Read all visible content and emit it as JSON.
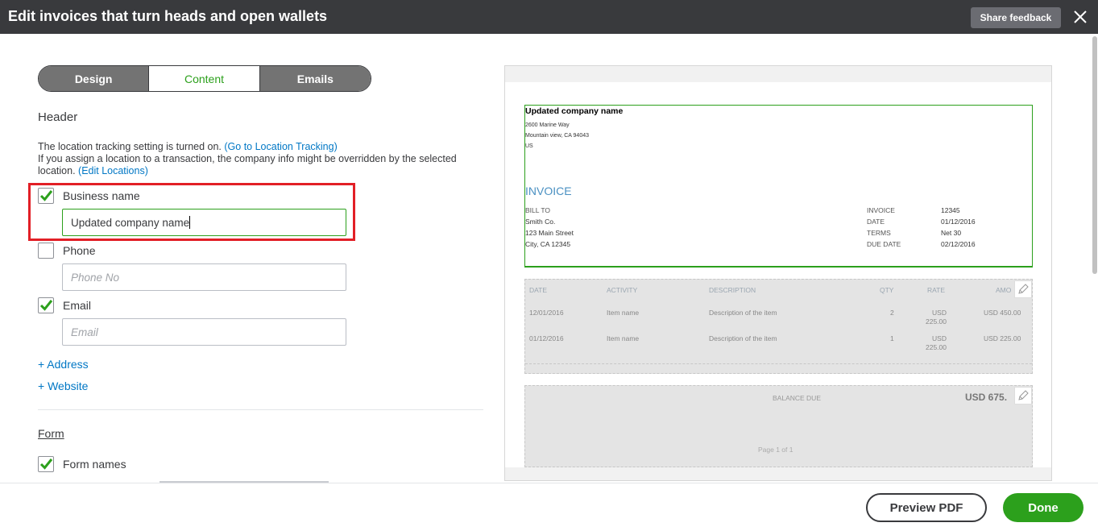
{
  "title": "Edit invoices that turn heads and open wallets",
  "share_feedback": "Share feedback",
  "tabs": [
    {
      "label": "Design"
    },
    {
      "label": "Content"
    },
    {
      "label": "Emails"
    }
  ],
  "header_section": {
    "title": "Header",
    "info_line1": "The location tracking setting is turned on. ",
    "info_link1": "(Go to Location Tracking)",
    "info_line2": "If you assign a location to a transaction, the company info might be overridden by the selected location. ",
    "info_link2": "(Edit Locations)",
    "business_name": {
      "label": "Business name",
      "checked": true,
      "value": "Updated company name"
    },
    "phone": {
      "label": "Phone",
      "checked": false,
      "placeholder": "Phone No"
    },
    "email": {
      "label": "Email",
      "checked": true,
      "placeholder": "Email"
    },
    "add_address": "+ Address",
    "add_website": "+ Website"
  },
  "form_section": {
    "title": "Form",
    "form_names": {
      "label": "Form names",
      "checked": true
    }
  },
  "preview": {
    "company_name": "Updated company name",
    "address_lines": [
      "2600 Marine Way",
      "Mountain view, CA 94043",
      "US"
    ],
    "invoice_title": "INVOICE",
    "bill_to_label": "BILL TO",
    "bill_to_lines": [
      "Smith Co.",
      "123 Main Street",
      "City, CA 12345"
    ],
    "meta": [
      {
        "label": "INVOICE",
        "value": "12345"
      },
      {
        "label": "DATE",
        "value": "01/12/2016"
      },
      {
        "label": "TERMS",
        "value": "Net 30"
      },
      {
        "label": "DUE DATE",
        "value": "02/12/2016"
      }
    ],
    "columns": [
      "DATE",
      "ACTIVITY",
      "DESCRIPTION",
      "QTY",
      "RATE",
      "AMO"
    ],
    "rows": [
      {
        "date": "12/01/2016",
        "activity": "Item name",
        "description": "Description of the item",
        "qty": "2",
        "rate_line1": "USD",
        "rate_line2": "225.00",
        "amount": "USD 450.00"
      },
      {
        "date": "01/12/2016",
        "activity": "Item name",
        "description": "Description of the item",
        "qty": "1",
        "rate_line1": "USD",
        "rate_line2": "225.00",
        "amount": "USD 225.00"
      }
    ],
    "balance_due_label": "BALANCE DUE",
    "balance_due_value": "USD 675.",
    "page": "Page 1 of 1"
  },
  "footer": {
    "preview_pdf": "Preview PDF",
    "done": "Done"
  },
  "colors": {
    "accent": "#2ca01c",
    "link": "#0077c5",
    "titlebar": "#393a3d",
    "highlight": "#e21f26"
  }
}
